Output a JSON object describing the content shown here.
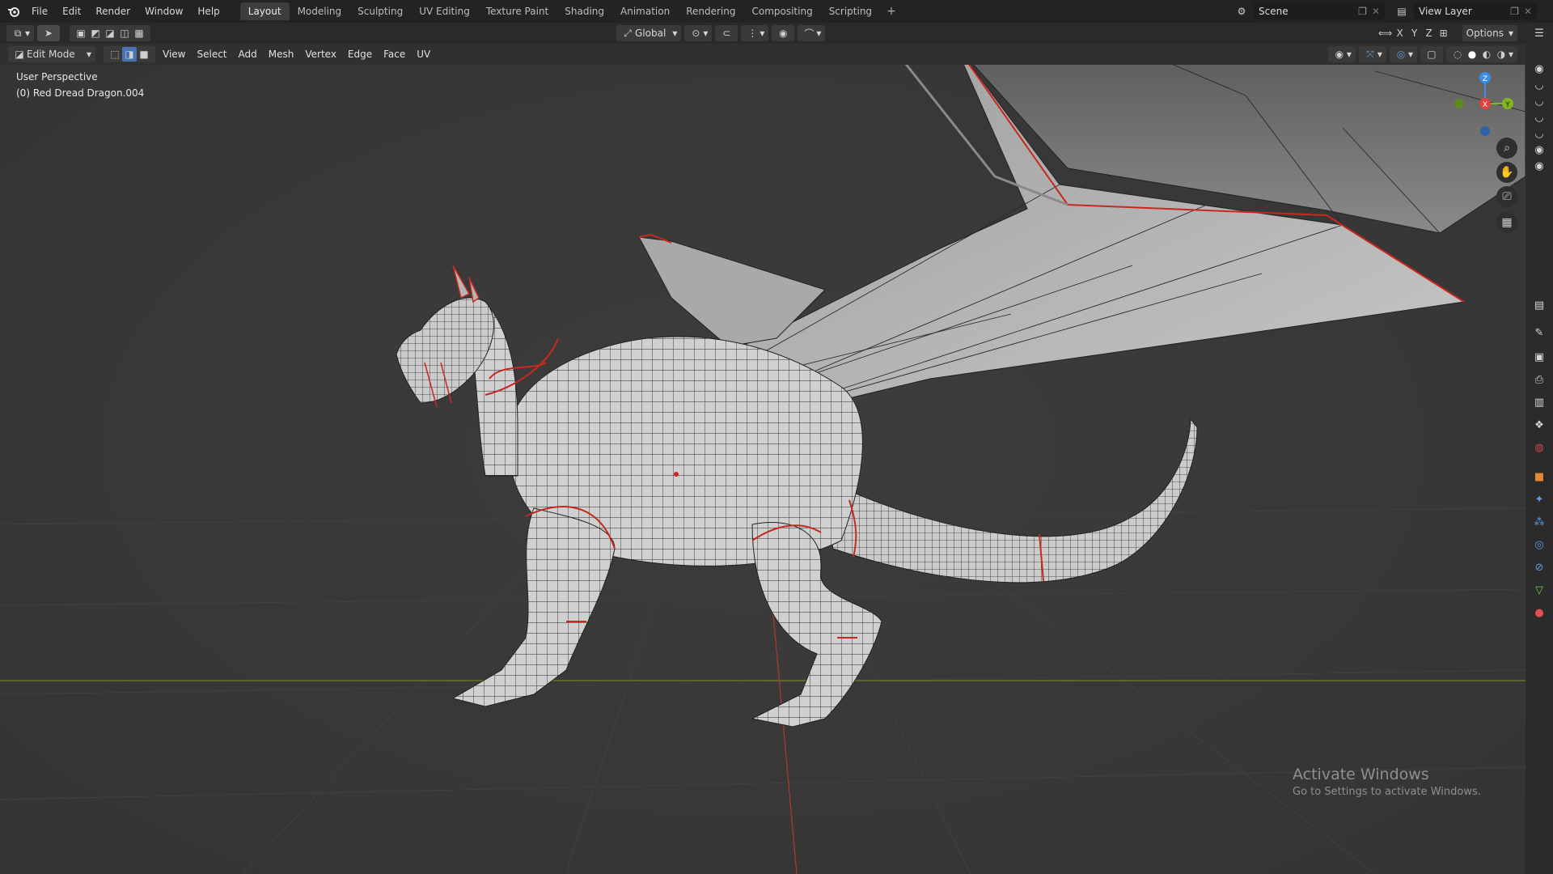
{
  "topbar": {
    "menus": [
      "File",
      "Edit",
      "Render",
      "Window",
      "Help"
    ],
    "workspaces": [
      "Layout",
      "Modeling",
      "Sculpting",
      "UV Editing",
      "Texture Paint",
      "Shading",
      "Animation",
      "Rendering",
      "Compositing",
      "Scripting"
    ],
    "active_workspace": "Layout",
    "add_workspace": "+",
    "scene": "Scene",
    "view_layer": "View Layer"
  },
  "header": {
    "transform_orientation": "Global",
    "axes": [
      "X",
      "Y",
      "Z"
    ],
    "options_label": "Options",
    "mode": "Edit Mode",
    "menus": [
      "View",
      "Select",
      "Add",
      "Mesh",
      "Vertex",
      "Edge",
      "Face",
      "UV"
    ]
  },
  "viewport": {
    "view_name": "User Perspective",
    "object_name": "(0) Red Dread Dragon.004",
    "gizmo": {
      "z": "Z",
      "x": "X",
      "y": "Y"
    }
  },
  "watermark": {
    "title": "Activate Windows",
    "subtitle": "Go to Settings to activate Windows."
  },
  "colors": {
    "seam": "#c8281e",
    "mesh": "#cfcfcf",
    "wire": "#262626",
    "floor_line": "#7a7a2e",
    "axis_x": "#e0413d",
    "axis_y": "#7fb51f",
    "axis_z": "#3b8ee8"
  }
}
